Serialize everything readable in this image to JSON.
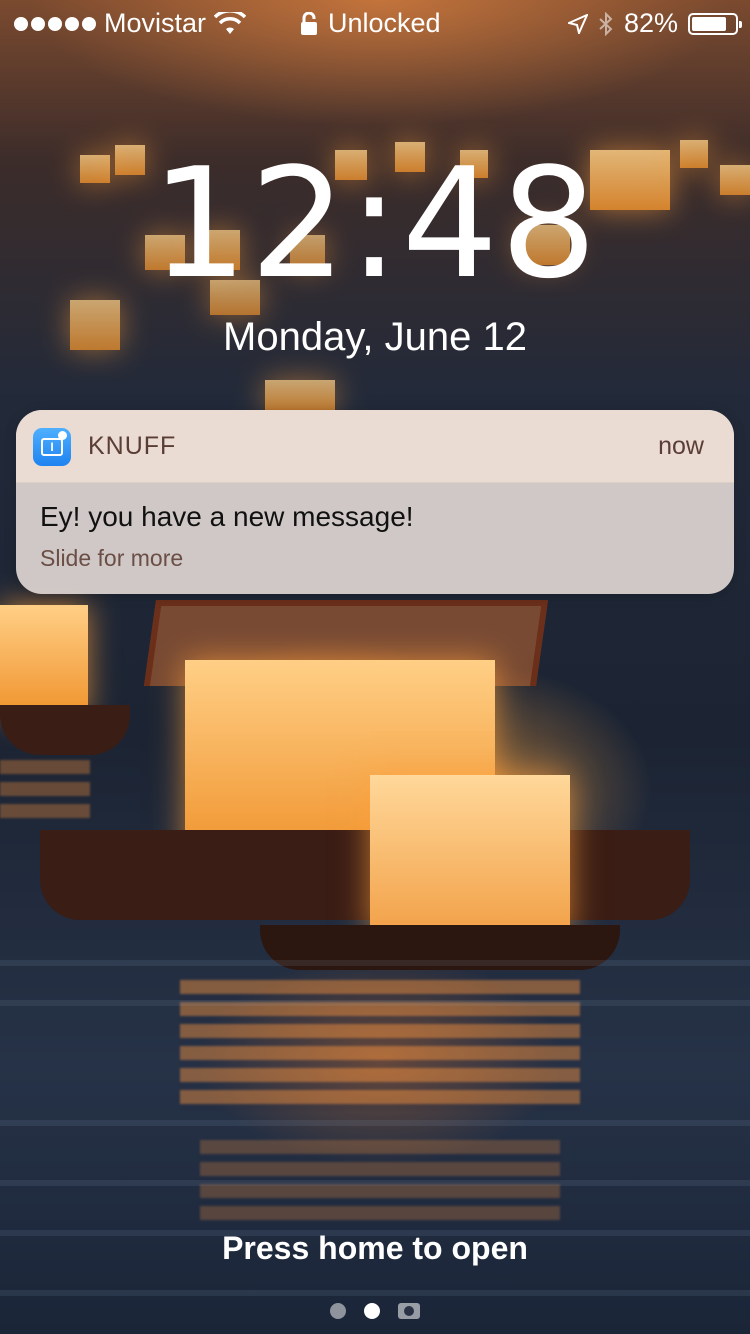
{
  "status_bar": {
    "carrier": "Movistar",
    "signal_dots": 5,
    "lock_label": "Unlocked",
    "battery_percent": "82%",
    "battery_level": 0.82
  },
  "lockscreen": {
    "time": "12:48",
    "date": "Monday, June 12"
  },
  "notification": {
    "app_name": "KNUFF",
    "time": "now",
    "title": "Ey! you have a new message!",
    "subtitle": "Slide for more",
    "app_icon": "knuff-app-icon",
    "accent": "#1e83f0"
  },
  "footer": {
    "prompt": "Press home to open",
    "pages": 2,
    "active_page": 1
  }
}
